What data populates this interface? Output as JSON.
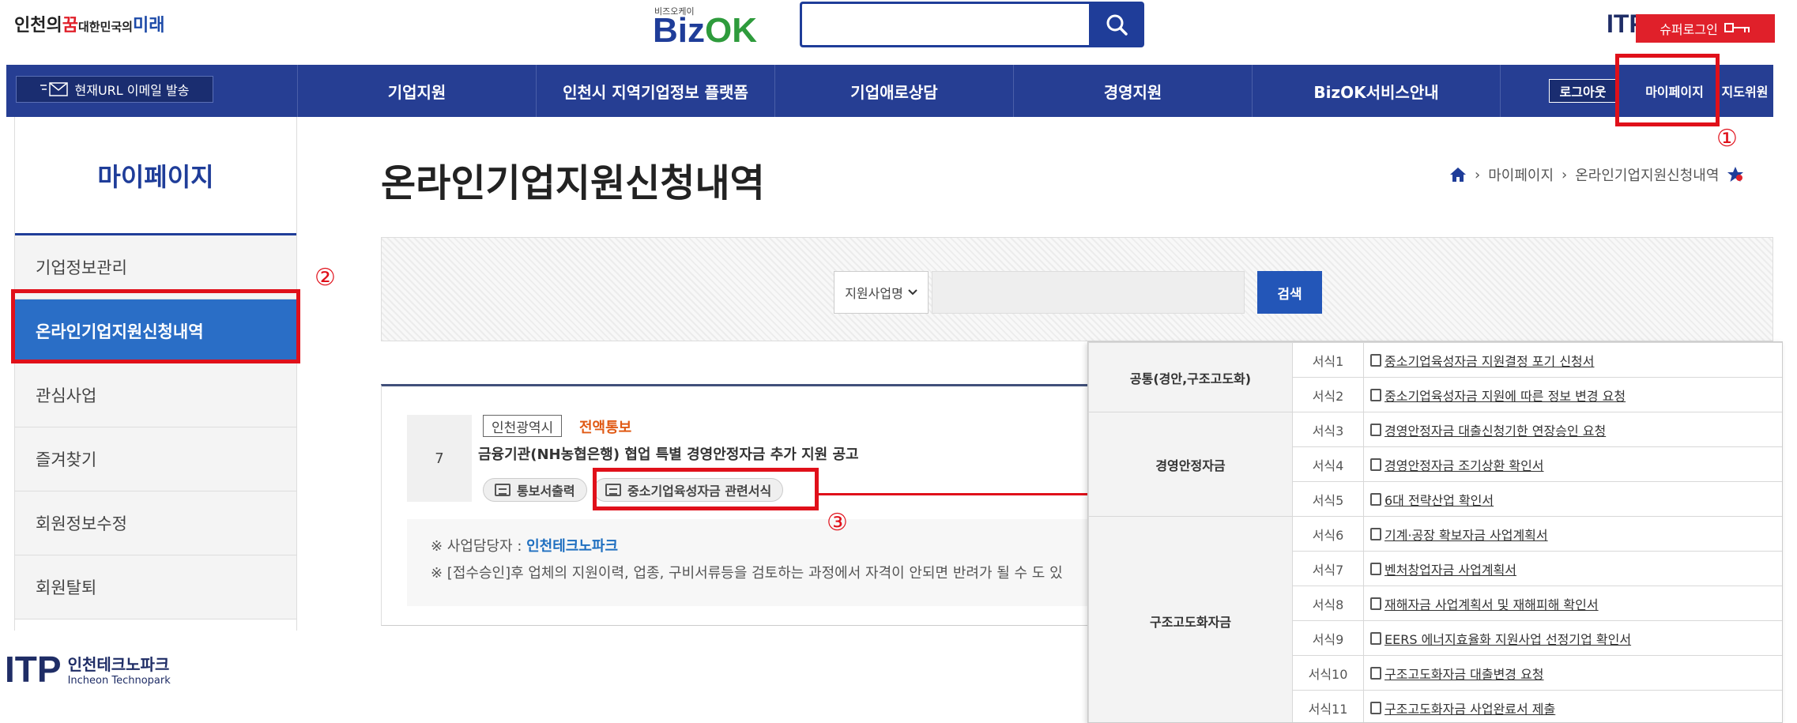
{
  "header": {
    "slogan_1": "인천의",
    "slogan_dream": "꿈",
    "slogan_2": "대한민국의",
    "slogan_future": "미래",
    "bizok_small": "비즈오케이",
    "bizok_biz": "Biz",
    "bizok_ok": "OK",
    "search_placeholder": "",
    "itp_mark": "ITP",
    "super_login_label": "슈퍼로그인"
  },
  "nav": {
    "email_label": "현재URL 이메일 발송",
    "items": [
      "기업지원",
      "인천시 지역기업정보 플랫폼",
      "기업애로상담",
      "경영지원",
      "BizOK서비스안내"
    ],
    "logout": "로그아웃",
    "mypage": "마이페이지",
    "guide": "지도위원"
  },
  "annotations": {
    "n1": "①",
    "n2": "②",
    "n3": "③"
  },
  "sidebar": {
    "title": "마이페이지",
    "items": [
      {
        "label": "기업정보관리"
      },
      {
        "label": "온라인기업지원신청내역"
      },
      {
        "label": "관심사업"
      },
      {
        "label": "즐겨찾기"
      },
      {
        "label": "회원정보수정"
      },
      {
        "label": "회원탈퇴"
      }
    ]
  },
  "footer_logo": {
    "mark": "ITP",
    "ko": "인천테크노파크",
    "en": "Incheon Technopark"
  },
  "main": {
    "title": "온라인기업지원신청내역",
    "breadcrumb": [
      "마이페이지",
      "온라인기업지원신청내역"
    ],
    "search": {
      "select_value": "지원사업명",
      "button": "검색",
      "input_value": ""
    },
    "row": {
      "number": "7",
      "region": "인천광역시",
      "kind": "전액통보",
      "title": "금융기관(NH농협은행) 협업 특별 경영안정자금 추가 지원 공고",
      "btn_print": "통보서출력",
      "btn_forms": "중소기업육성자금 관련서식"
    },
    "notice": {
      "line1_prefix": "※ 사업담당자 : ",
      "line1_value": "인천테크노파크",
      "line2": "※ [접수승인]후 업체의 지원이력, 업종, 구비서류등을 검토하는 과정에서 자격이 안되면 반려가 될 수 도 있"
    }
  },
  "forms_popup": {
    "groups": [
      {
        "category": "공통(경안,구조고도화)",
        "rows": [
          {
            "code": "서식1",
            "name": "중소기업육성자금 지원결정 포기 신청서"
          },
          {
            "code": "서식2",
            "name": "중소기업육성자금 지원에 따른 정보 변경 요청"
          }
        ]
      },
      {
        "category": "경영안정자금",
        "rows": [
          {
            "code": "서식3",
            "name": "경영안정자금 대출신청기한 연장승인 요청"
          },
          {
            "code": "서식4",
            "name": "경영안정자금 조기상환 확인서"
          },
          {
            "code": "서식5",
            "name": "6대 전략산업 확인서"
          }
        ]
      },
      {
        "category": "구조고도화자금",
        "rows": [
          {
            "code": "서식6",
            "name": "기계·공장 확보자금 사업계획서"
          },
          {
            "code": "서식7",
            "name": "벤처창업자금 사업계획서"
          },
          {
            "code": "서식8",
            "name": "재해자금 사업계획서 및 재해피해 확인서"
          },
          {
            "code": "서식9",
            "name": "EERS 에너지효율화 지원사업 선정기업 확인서"
          },
          {
            "code": "서식10",
            "name": "구조고도화자금 대출변경 요청"
          },
          {
            "code": "서식11",
            "name": "구조고도화자금 사업완료서 제출"
          }
        ]
      }
    ]
  },
  "colors": {
    "nav": "#263e93",
    "accent_red": "#e0101a",
    "active_side": "#2a6ec6",
    "kind_orange": "#e05a15"
  }
}
